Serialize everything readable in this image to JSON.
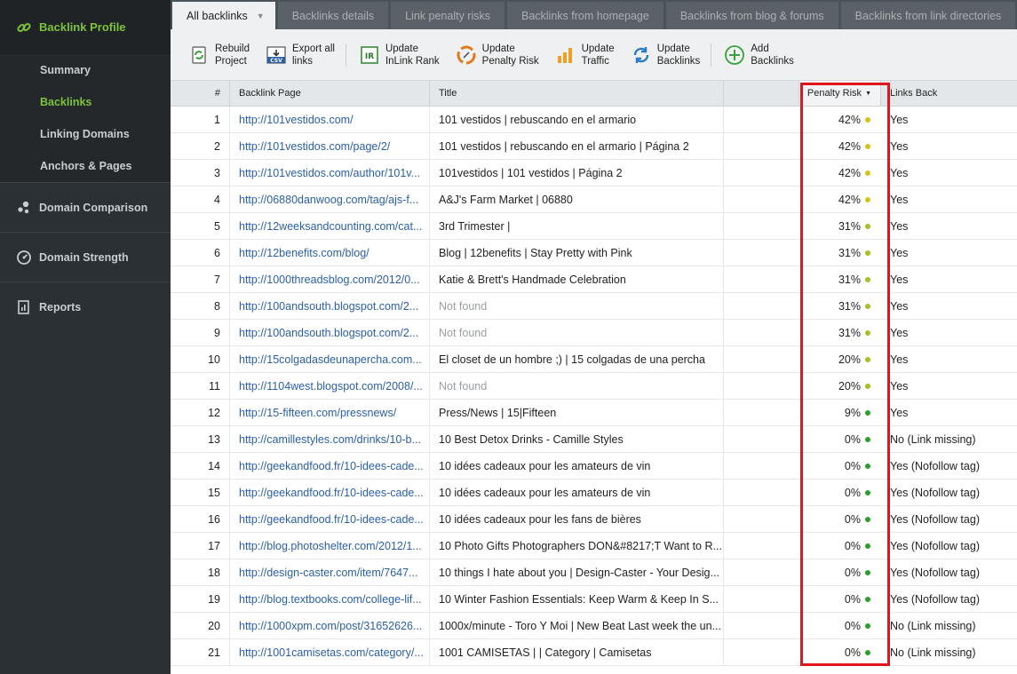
{
  "sidebar": {
    "header": {
      "label": "Backlink Profile",
      "icon": "link-icon"
    },
    "sub_items": [
      {
        "label": "Summary",
        "active": false
      },
      {
        "label": "Backlinks",
        "active": true
      },
      {
        "label": "Linking Domains",
        "active": false
      },
      {
        "label": "Anchors & Pages",
        "active": false
      }
    ],
    "sections": [
      {
        "label": "Domain Comparison",
        "icon": "bubbles-icon"
      },
      {
        "label": "Domain Strength",
        "icon": "gauge-icon"
      },
      {
        "label": "Reports",
        "icon": "report-icon"
      }
    ]
  },
  "tabs": [
    {
      "label": "All backlinks",
      "active": true
    },
    {
      "label": "Backlinks details"
    },
    {
      "label": "Link penalty risks"
    },
    {
      "label": "Backlinks from homepage"
    },
    {
      "label": "Backlinks from blog & forums"
    },
    {
      "label": "Backlinks from link directories"
    }
  ],
  "toolbar": [
    {
      "line1": "Rebuild",
      "line2": "Project",
      "icon": "rebuild-icon"
    },
    {
      "line1": "Export all",
      "line2": "links",
      "icon": "csv-export-icon"
    },
    {
      "line1": "Update",
      "line2": "InLink Rank",
      "icon": "inlink-rank-icon"
    },
    {
      "line1": "Update",
      "line2": "Penalty Risk",
      "icon": "penalty-risk-icon"
    },
    {
      "line1": "Update",
      "line2": "Traffic",
      "icon": "traffic-icon"
    },
    {
      "line1": "Update",
      "line2": "Backlinks",
      "icon": "refresh-icon"
    },
    {
      "line1": "Add",
      "line2": "Backlinks",
      "icon": "add-icon"
    }
  ],
  "table": {
    "headers": {
      "num": "#",
      "page": "Backlink Page",
      "title": "Title",
      "risk": "Penalty Risk",
      "sort_icon": "sort-desc-icon",
      "back": "Links Back"
    },
    "colors": {
      "yellow": "#d8c21a",
      "lime": "#a8c020",
      "green": "#2aa02a"
    },
    "rows": [
      {
        "num": "1",
        "page": "http://101vestidos.com/",
        "title": "101 vestidos | rebuscando en el armario",
        "risk": "42%",
        "dot": "yellow",
        "back": "Yes"
      },
      {
        "num": "2",
        "page": "http://101vestidos.com/page/2/",
        "title": "101 vestidos | rebuscando en el armario | Página 2",
        "risk": "42%",
        "dot": "yellow",
        "back": "Yes"
      },
      {
        "num": "3",
        "page": "http://101vestidos.com/author/101v...",
        "title": "101vestidos | 101 vestidos | Página 2",
        "risk": "42%",
        "dot": "yellow",
        "back": "Yes"
      },
      {
        "num": "4",
        "page": "http://06880danwoog.com/tag/ajs-f...",
        "title": "A&J's Farm Market | 06880",
        "risk": "42%",
        "dot": "yellow",
        "back": "Yes"
      },
      {
        "num": "5",
        "page": "http://12weeksandcounting.com/cat...",
        "title": "3rd Trimester |",
        "risk": "31%",
        "dot": "lime",
        "back": "Yes"
      },
      {
        "num": "6",
        "page": "http://12benefits.com/blog/",
        "title": "Blog | 12benefits | Stay Pretty with Pink",
        "risk": "31%",
        "dot": "lime",
        "back": "Yes"
      },
      {
        "num": "7",
        "page": "http://1000threadsblog.com/2012/0...",
        "title": "Katie & Brett's Handmade Celebration",
        "risk": "31%",
        "dot": "lime",
        "back": "Yes"
      },
      {
        "num": "8",
        "page": "http://100andsouth.blogspot.com/2...",
        "title": "Not found",
        "nf": true,
        "risk": "31%",
        "dot": "lime",
        "back": "Yes"
      },
      {
        "num": "9",
        "page": "http://100andsouth.blogspot.com/2...",
        "title": "Not found",
        "nf": true,
        "risk": "31%",
        "dot": "lime",
        "back": "Yes"
      },
      {
        "num": "10",
        "page": "http://15colgadasdeunapercha.com...",
        "title": "El closet de un hombre ;) | 15 colgadas de una percha",
        "risk": "20%",
        "dot": "lime",
        "back": "Yes"
      },
      {
        "num": "11",
        "page": "http://1104west.blogspot.com/2008/...",
        "title": "Not found",
        "nf": true,
        "risk": "20%",
        "dot": "lime",
        "back": "Yes"
      },
      {
        "num": "12",
        "page": "http://15-fifteen.com/pressnews/",
        "title": "Press/News | 15|Fifteen",
        "risk": "9%",
        "dot": "green",
        "back": "Yes"
      },
      {
        "num": "13",
        "page": "http://camillestyles.com/drinks/10-b...",
        "title": "10 Best Detox Drinks - Camille Styles",
        "risk": "0%",
        "dot": "green",
        "back": "No (Link missing)"
      },
      {
        "num": "14",
        "page": "http://geekandfood.fr/10-idees-cade...",
        "title": "10 idées cadeaux pour les amateurs de vin",
        "risk": "0%",
        "dot": "green",
        "back": "Yes (Nofollow tag)"
      },
      {
        "num": "15",
        "page": "http://geekandfood.fr/10-idees-cade...",
        "title": "10 idées cadeaux pour les amateurs de vin",
        "risk": "0%",
        "dot": "green",
        "back": "Yes (Nofollow tag)"
      },
      {
        "num": "16",
        "page": "http://geekandfood.fr/10-idees-cade...",
        "title": "10 idées cadeaux pour les fans de bières",
        "risk": "0%",
        "dot": "green",
        "back": "Yes (Nofollow tag)"
      },
      {
        "num": "17",
        "page": "http://blog.photoshelter.com/2012/1...",
        "title": "10 Photo Gifts Photographers DON&#8217;T Want to R...",
        "risk": "0%",
        "dot": "green",
        "back": "Yes (Nofollow tag)"
      },
      {
        "num": "18",
        "page": "http://design-caster.com/item/7647...",
        "title": "10 things I hate about you | Design-Caster - Your Desig...",
        "risk": "0%",
        "dot": "green",
        "back": "Yes (Nofollow tag)"
      },
      {
        "num": "19",
        "page": "http://blog.textbooks.com/college-lif...",
        "title": "10 Winter Fashion Essentials: Keep Warm & Keep In S...",
        "risk": "0%",
        "dot": "green",
        "back": "Yes (Nofollow tag)"
      },
      {
        "num": "20",
        "page": "http://1000xpm.com/post/31652626...",
        "title": "1000x/minute - Toro Y Moi | New Beat Last week the un...",
        "risk": "0%",
        "dot": "green",
        "back": "No (Link missing)"
      },
      {
        "num": "21",
        "page": "http://1001camisetas.com/category/...",
        "title": "1001 CAMISETAS | | Category | Camisetas",
        "risk": "0%",
        "dot": "green",
        "back": "No (Link missing)"
      }
    ]
  }
}
